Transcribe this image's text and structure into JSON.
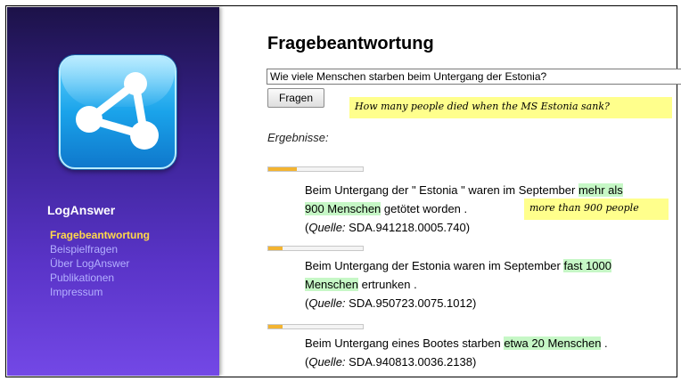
{
  "sidebar": {
    "logo_icon": "share-network-icon",
    "brand": "LogAnswer",
    "items": [
      {
        "label": "Fragebeantwortung",
        "active": true
      },
      {
        "label": "Beispielfragen",
        "active": false
      },
      {
        "label": "Über LogAnswer",
        "active": false
      },
      {
        "label": "Publikationen",
        "active": false
      },
      {
        "label": "Impressum",
        "active": false
      }
    ],
    "active_color": "#ffd84a",
    "item_color": "#b4b0ff"
  },
  "main": {
    "title": "Fragebeantwortung",
    "question_value": "Wie viele Menschen starben beim Untergang der Estonia?",
    "ask_button": "Fragen",
    "translation_note": "How many people died when the MS Estonia sank?",
    "results_label": "Ergebnisse:",
    "source_label": "Quelle:",
    "highlight_color": "#c6f7c6",
    "score_color": "#f3b431",
    "results": [
      {
        "score": 0.3,
        "line1_before": "Beim Untergang der \" Estonia \" waren im September ",
        "line1_highlight": "mehr als",
        "line2_highlight": "900 Menschen",
        "line2_after": " getötet worden .",
        "source": "SDA.941218.0005.740)",
        "note": "more than 900 people"
      },
      {
        "score": 0.15,
        "line1_before": "Beim Untergang der Estonia waren im September ",
        "line1_highlight": "fast 1000",
        "line2_highlight": "Menschen",
        "line2_after": " ertrunken .",
        "source": "SDA.950723.0075.1012)"
      },
      {
        "score": 0.15,
        "line1_before": "Beim Untergang eines Bootes starben ",
        "line1_highlight": "etwa 20 Menschen",
        "line1_after": " .",
        "source": "SDA.940813.0036.2138)"
      }
    ]
  }
}
